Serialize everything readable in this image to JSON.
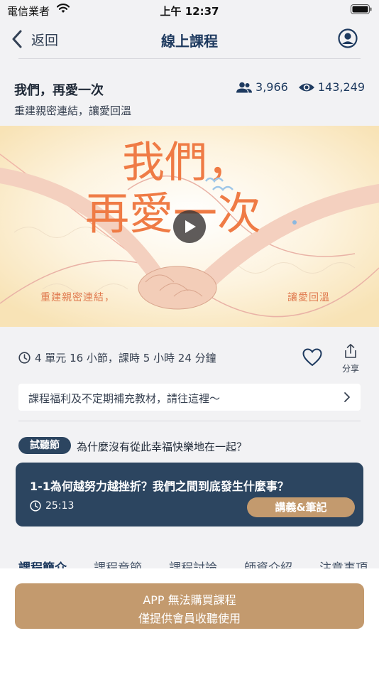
{
  "status_bar": {
    "carrier": "電信業者",
    "time": "上午 12:37"
  },
  "nav": {
    "back_label": "返回",
    "title": "線上課程"
  },
  "course": {
    "title": "我們，再愛一次",
    "subtitle": "重建親密連結，讓愛回溫",
    "students": "3,966",
    "views": "143,249"
  },
  "banner": {
    "title_line1": "我們，",
    "title_line2": "再愛一次",
    "caption_left": "重建親密連結，",
    "caption_right": "讓愛回溫"
  },
  "meta": {
    "duration": "4 單元 16 小節，課時 5 小時 24 分鐘",
    "share_label": "分享"
  },
  "benefits": {
    "text": "課程福利及不定期補充教材，請往這裡～"
  },
  "trial": {
    "badge": "試聽節",
    "title": "為什麼沒有從此幸福快樂地在一起？",
    "lesson_title": "1-1為何越努力越挫折？我們之間到底發生什麼事？",
    "lesson_time": "25:13",
    "notes_button": "講義&筆記"
  },
  "tabs": [
    {
      "label": "課程簡介",
      "active": true
    },
    {
      "label": "課程章節"
    },
    {
      "label": "課程討論"
    },
    {
      "label": "師資介紹"
    },
    {
      "label": "注意事項"
    }
  ],
  "buy": {
    "line1": "APP 無法購買課程",
    "line2": "僅提供會員收聽使用"
  },
  "colors": {
    "navy": "#2c4560",
    "accent": "#c39a6e",
    "background": "#f2f2f4"
  },
  "icons": [
    "wifi-icon",
    "battery-icon",
    "chevron-left-icon",
    "user-circle-icon",
    "users-icon",
    "eye-icon",
    "play-icon",
    "clock-icon",
    "heart-icon",
    "share-icon",
    "chevron-right-icon"
  ]
}
